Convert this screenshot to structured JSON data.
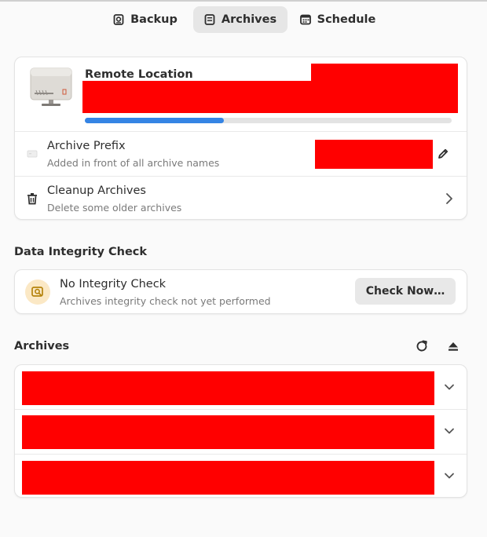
{
  "tabs": [
    {
      "label": "Backup",
      "icon": "backup-icon"
    },
    {
      "label": "Archives",
      "icon": "archives-icon",
      "active": true
    },
    {
      "label": "Schedule",
      "icon": "calendar-icon"
    }
  ],
  "repository": {
    "title": "Remote Location",
    "progress": 0.38,
    "prefix_label": "Archive Prefix",
    "prefix_subtitle": "Added in front of all archive names",
    "cleanup_label": "Cleanup Archives",
    "cleanup_subtitle": "Delete some older archives"
  },
  "integrity": {
    "section_title": "Data Integrity Check",
    "title": "No Integrity Check",
    "subtitle": "Archives integrity check not yet performed",
    "button_label": "Check Now…"
  },
  "archives": {
    "section_title": "Archives",
    "items_count_visible": 3
  },
  "colors": {
    "accent": "#3584e4",
    "redaction": "#ff0000",
    "integrity_badge_bg": "#fbe8c5",
    "integrity_badge_fg": "#b5830d"
  }
}
